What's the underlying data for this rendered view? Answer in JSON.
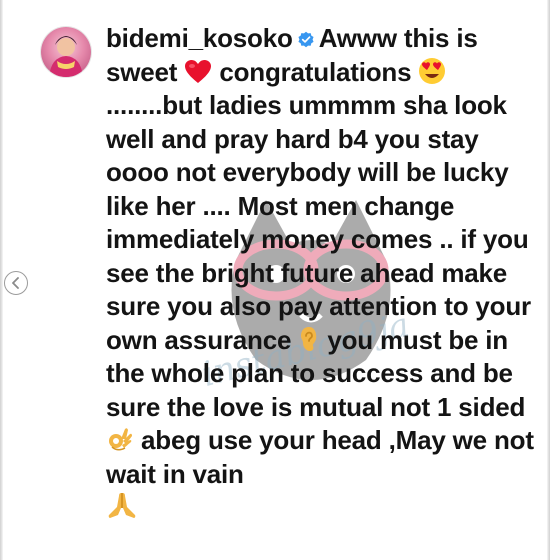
{
  "comment": {
    "username": "bidemi_kosoko",
    "segments": {
      "s1": "Awww this is sweet",
      "s2": "congratulations",
      "s3": "........but ladies ummmm sha look well and pray hard  b4 you stay oooo not everybody will be lucky like her .... Most men change immediately money comes .. if you see the bright future ahead make sure you also pay attention to your own assurance",
      "s4": "you must be in the whole plan to success and be sure the love is mutual not 1 sided",
      "s5": "abeg use your head ,May we not wait in vain"
    },
    "emojis": [
      "red-heart",
      "heart-eyes-face",
      "ear",
      "ok-hand",
      "folded-hands"
    ]
  },
  "icons": {
    "verified": "verified-badge-icon",
    "carousel_prev": "chevron-left-icon"
  },
  "watermark": {
    "text": "instablog9ja"
  },
  "colors": {
    "text": "#141414",
    "verified_blue": "#3897f0",
    "heart_red": "#e8112d",
    "emoji_yellow": "#ffcc33"
  }
}
